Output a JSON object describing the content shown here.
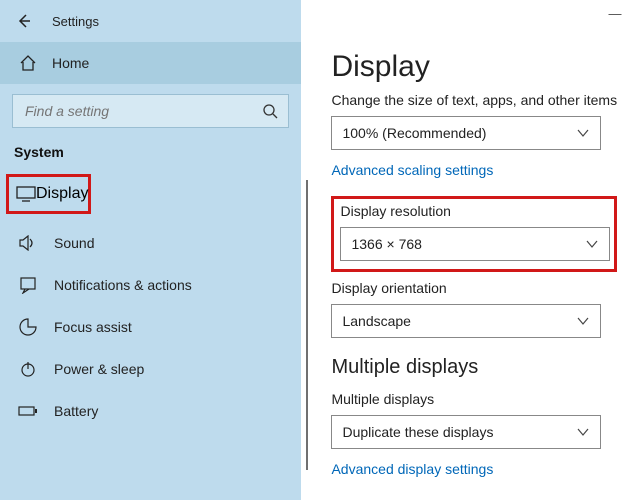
{
  "window": {
    "title": "Settings",
    "minimize": "—"
  },
  "sidebar": {
    "home": "Home",
    "search_placeholder": "Find a setting",
    "category": "System",
    "items": [
      {
        "label": "Display"
      },
      {
        "label": "Sound"
      },
      {
        "label": "Notifications & actions"
      },
      {
        "label": "Focus assist"
      },
      {
        "label": "Power & sleep"
      },
      {
        "label": "Battery"
      }
    ]
  },
  "main": {
    "heading": "Display",
    "scale_label": "Change the size of text, apps, and other items",
    "scale_value": "100% (Recommended)",
    "adv_scaling": "Advanced scaling settings",
    "resolution_label": "Display resolution",
    "resolution_value": "1366 × 768",
    "orientation_label": "Display orientation",
    "orientation_value": "Landscape",
    "multi_heading": "Multiple displays",
    "multi_label": "Multiple displays",
    "multi_value": "Duplicate these displays",
    "adv_display": "Advanced display settings"
  }
}
